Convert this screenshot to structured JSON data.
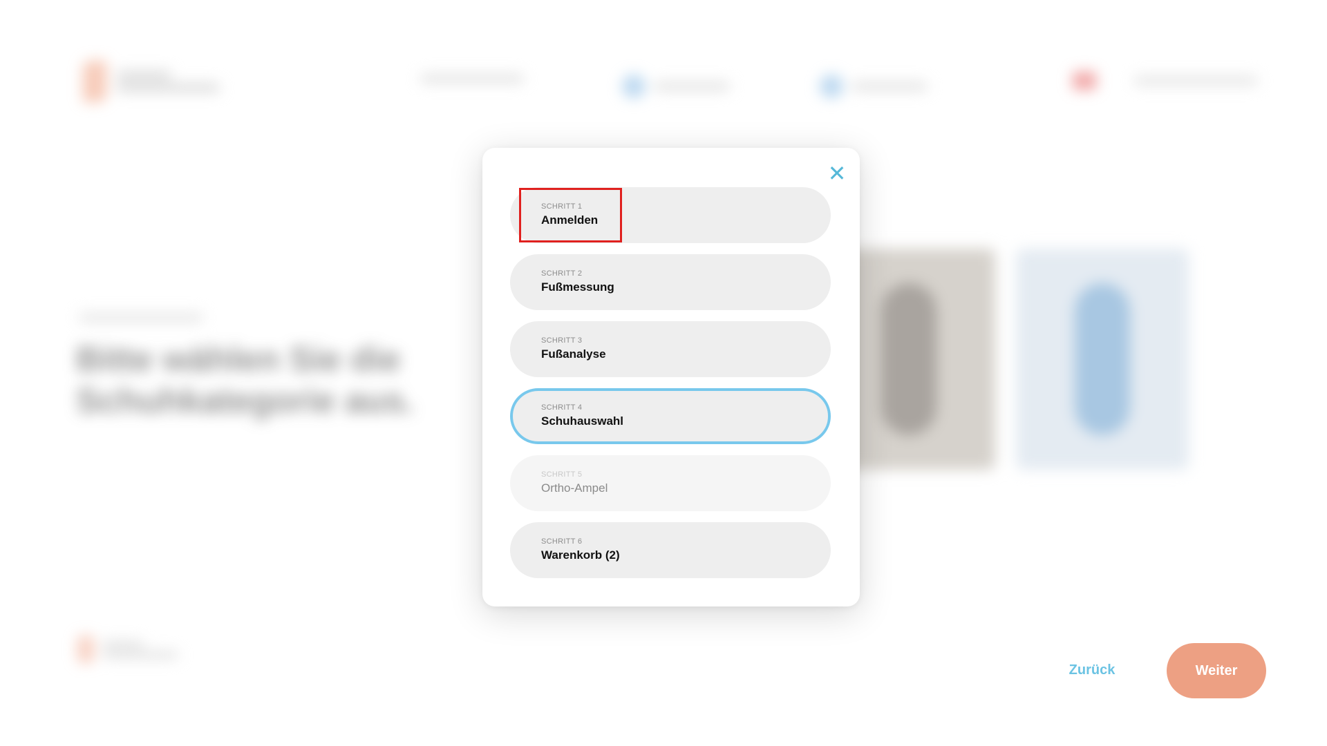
{
  "background": {
    "heading": "Bitte wählen Sie die Schuhkategorie aus."
  },
  "footer": {
    "back_label": "Zurück",
    "next_label": "Weiter"
  },
  "modal": {
    "close_icon": "close-icon",
    "steps": [
      {
        "kicker": "SCHRITT 1",
        "title": "Anmelden",
        "state": "default",
        "highlighted": true
      },
      {
        "kicker": "SCHRITT 2",
        "title": "Fußmessung",
        "state": "default"
      },
      {
        "kicker": "SCHRITT 3",
        "title": "Fußanalyse",
        "state": "default"
      },
      {
        "kicker": "SCHRITT 4",
        "title": "Schuhauswahl",
        "state": "active"
      },
      {
        "kicker": "SCHRITT 5",
        "title": "Ortho-Ampel",
        "state": "disabled"
      },
      {
        "kicker": "SCHRITT 6",
        "title": "Warenkorb (2)",
        "state": "default"
      }
    ]
  },
  "colors": {
    "accent": "#78c8ec",
    "close": "#55b8d8",
    "primary_button": "#eda083",
    "back_link": "#6bc3e3",
    "highlight": "#e0201e"
  }
}
